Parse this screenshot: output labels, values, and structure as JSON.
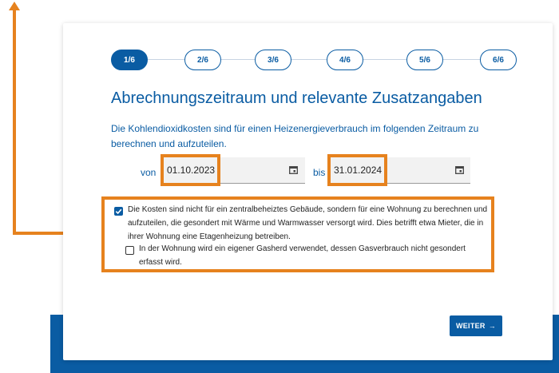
{
  "stepper": {
    "steps": [
      "1/6",
      "2/6",
      "3/6",
      "4/6",
      "5/6",
      "6/6"
    ],
    "active_index": 0
  },
  "title": "Abrechnungszeitraum und relevante Zusatzangaben",
  "description": "Die Kohlendioxidkosten sind für einen Heizenergieverbrauch im folgenden Zeitraum zu berechnen und aufzuteilen.",
  "period": {
    "from_label": "von",
    "from_value": "01.10.2023",
    "to_label": "bis",
    "to_value": "31.01.2024"
  },
  "checkboxes": {
    "central_heating": {
      "checked": true,
      "label": "Die Kosten sind nicht für ein zentralbeheiztes Gebäude, sondern für eine Wohnung zu berechnen und aufzuteilen, die gesondert mit Wärme und Warmwasser versorgt wird. Dies betrifft etwa Mieter, die in ihrer Wohnung eine Etagenheizung betreiben."
    },
    "gas_stove": {
      "checked": false,
      "label": "In der Wohnung wird ein eigener Gasherd verwendet, dessen Gasverbrauch nicht gesondert erfasst wird."
    }
  },
  "next_button": {
    "label": "WEITER",
    "icon": "arrow-right-icon"
  },
  "colors": {
    "primary": "#0a5ca3",
    "highlight": "#e6821e",
    "field_bg": "#f2f2f2"
  }
}
